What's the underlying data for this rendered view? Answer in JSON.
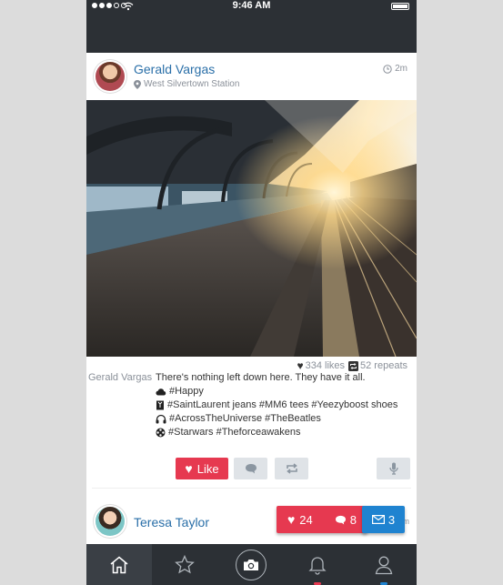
{
  "status_bar": {
    "time": "9:46 AM"
  },
  "post": {
    "author": "Gerald Vargas",
    "location": "West Silvertown Station",
    "timestamp": "2m",
    "likes": "334 likes",
    "repeats": "52 repeats",
    "caption_author": "Gerald Vargas",
    "caption_text": "There's nothing left down here. They have it all.",
    "tags": [
      {
        "icon": "cloud-icon",
        "text": "#Happy"
      },
      {
        "icon": "clothing-tag-icon",
        "text": "#SaintLaurent jeans #MM6 tees #Yeezyboost shoes"
      },
      {
        "icon": "headphones-icon",
        "text": "#AcrossTheUniverse #TheBeatles"
      },
      {
        "icon": "film-reel-icon",
        "text": "#Starwars #Theforceawakens"
      }
    ],
    "like_label": "Like"
  },
  "next_post": {
    "author": "Teresa Taylor",
    "timestamp_partial": "m"
  },
  "notifications": {
    "likes": "24",
    "comments": "8",
    "messages": "3"
  },
  "tabs": [
    {
      "icon": "home-icon"
    },
    {
      "icon": "star-icon"
    },
    {
      "icon": "camera-icon"
    },
    {
      "icon": "bell-icon"
    },
    {
      "icon": "profile-icon"
    }
  ],
  "colors": {
    "bar": "#2c3035",
    "accent_red": "#e63950",
    "accent_blue": "#1f83d0",
    "link_blue": "#2a6fa8"
  }
}
